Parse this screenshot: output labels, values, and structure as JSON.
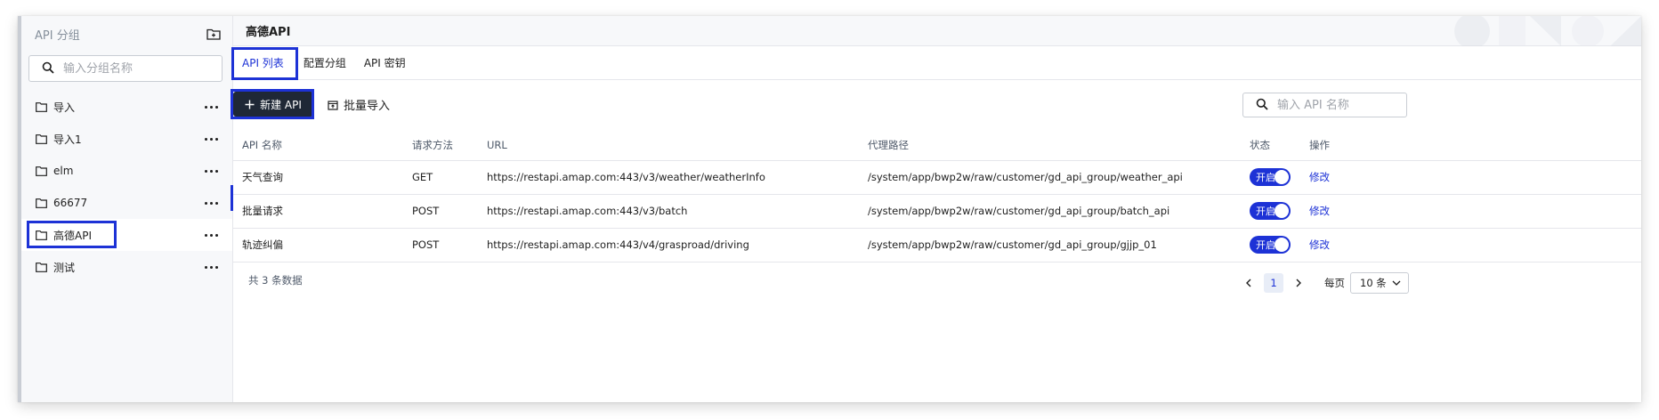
{
  "sidebar": {
    "title": "API 分组",
    "search_placeholder": "输入分组名称",
    "groups": [
      {
        "label": "导入"
      },
      {
        "label": "导入1"
      },
      {
        "label": "elm"
      },
      {
        "label": "66677"
      },
      {
        "label": "高德API"
      },
      {
        "label": "测试"
      }
    ],
    "active_index": 4
  },
  "main": {
    "title": "高德API",
    "tabs": [
      {
        "label": "API 列表"
      },
      {
        "label": "配置分组"
      },
      {
        "label": "API 密钥"
      }
    ],
    "active_tab": 0,
    "toolbar": {
      "new_label": "新建 API",
      "import_label": "批量导入",
      "search_placeholder": "输入 API 名称"
    },
    "table": {
      "columns": [
        "API 名称",
        "请求方法",
        "URL",
        "代理路径",
        "状态",
        "操作"
      ],
      "rows": [
        {
          "name": "天气查询",
          "method": "GET",
          "url": "https://restapi.amap.com:443/v3/weather/weatherInfo",
          "path": "/system/app/bwp2w/raw/customer/gd_api_group/weather_api",
          "status": "开启",
          "action": "修改"
        },
        {
          "name": "批量请求",
          "method": "POST",
          "url": "https://restapi.amap.com:443/v3/batch",
          "path": "/system/app/bwp2w/raw/customer/gd_api_group/batch_api",
          "status": "开启",
          "action": "修改"
        },
        {
          "name": "轨迹纠偏",
          "method": "POST",
          "url": "https://restapi.amap.com:443/v4/grasproad/driving",
          "path": "/system/app/bwp2w/raw/customer/gd_api_group/gjjp_01",
          "status": "开启",
          "action": "修改"
        }
      ]
    },
    "footer": {
      "total_text": "共 3 条数据",
      "current_page": "1",
      "per_page_label": "每页",
      "per_page_value": "10 条"
    }
  },
  "colors": {
    "accent": "#1d32d6",
    "primary_button": "#1f2836",
    "sidebar_bg": "#f7f8fa"
  }
}
